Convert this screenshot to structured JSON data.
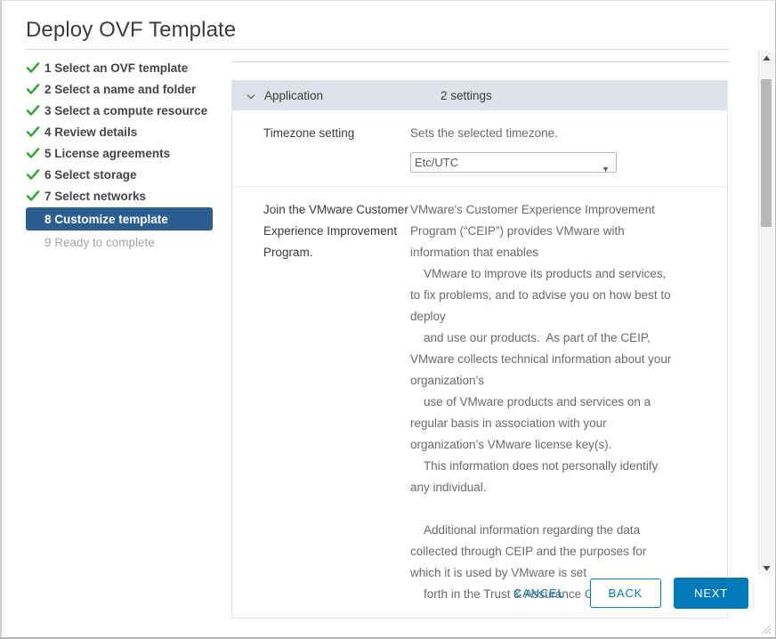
{
  "window": {
    "title": "Deploy OVF Template"
  },
  "steps": [
    {
      "num": "1",
      "label": "1 Select an OVF template",
      "state": "done"
    },
    {
      "num": "2",
      "label": "2 Select a name and folder",
      "state": "done"
    },
    {
      "num": "3",
      "label": "3 Select a compute resource",
      "state": "done"
    },
    {
      "num": "4",
      "label": "4 Review details",
      "state": "done"
    },
    {
      "num": "5",
      "label": "5 License agreements",
      "state": "done"
    },
    {
      "num": "6",
      "label": "6 Select storage",
      "state": "done"
    },
    {
      "num": "7",
      "label": "7 Select networks",
      "state": "done"
    },
    {
      "num": "8",
      "label": "8 Customize template",
      "state": "current"
    },
    {
      "num": "9",
      "label": "9 Ready to complete",
      "state": "pending"
    }
  ],
  "section": {
    "name": "Application",
    "count": "2 settings",
    "chevron": "chevron-down-icon"
  },
  "settings": [
    {
      "key": "Timezone setting",
      "description": "Sets the selected timezone.",
      "control": "select",
      "value": "Etc/UTC",
      "options": [
        "Etc/UTC"
      ]
    },
    {
      "key": "Join the VMware Customer Experience Improvement Program.",
      "description": "VMware's Customer Experience Improvement\nProgram (“CEIP”) provides VMware with\ninformation that enables\n    VMware to improve its products and services,\nto fix problems, and to advise you on how best to\ndeploy\n    and use our products.  As part of the CEIP,\nVMware collects technical information about your\norganization’s\n    use of VMware products and services on a\nregular basis in association with your\norganization’s VMware license key(s).\n    This information does not personally identify\nany individual.\n\n    Additional information regarding the data\ncollected through CEIP and the purposes for\nwhich it is used by VMware is set\n    forth in the Trust & Assurance Center at",
      "control": "text"
    }
  ],
  "footer": {
    "cancel_label": "CANCEL",
    "back_label": "BACK",
    "next_label": "NEXT"
  },
  "scrollbar": {
    "up_icon": "scroll-up-arrow-icon",
    "down_icon": "scroll-down-arrow-icon"
  },
  "colors": {
    "accent": "#0079b8",
    "step_selected_bg": "#2c5d8f",
    "section_header_bg": "#dde3e9",
    "check_green": "#3ba33b"
  }
}
